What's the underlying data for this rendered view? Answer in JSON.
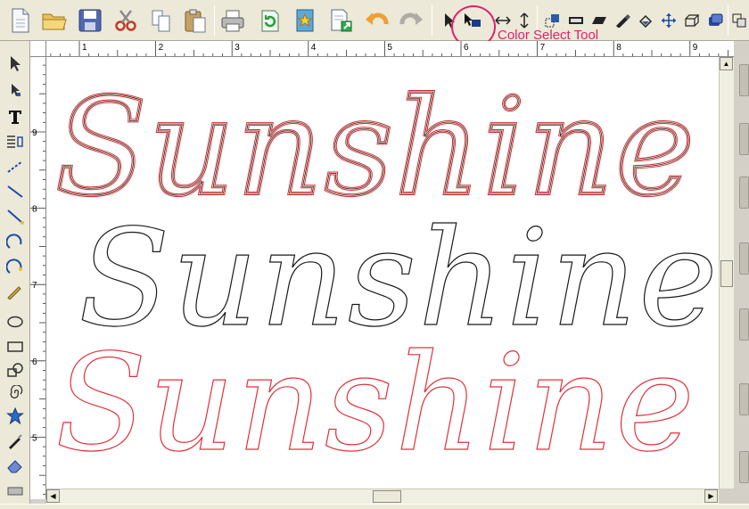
{
  "callout": {
    "label": "Color Select Tool"
  },
  "ruler": {
    "h_labels": [
      "1",
      "2",
      "3",
      "4",
      "5",
      "6",
      "7",
      "8",
      "9"
    ],
    "v_labels": [
      "9",
      "8",
      "7",
      "6",
      "5"
    ]
  },
  "canvas": {
    "words": [
      {
        "text": "Sunshine",
        "style": "outline-red-double",
        "stroke": "#d42a2a"
      },
      {
        "text": "Sunshine",
        "style": "outline-black",
        "stroke": "#1a1a1a"
      },
      {
        "text": "Sunshine",
        "style": "outline-red",
        "stroke": "#e0303a"
      }
    ]
  },
  "toolbar": {
    "icons": [
      "new-document",
      "open-folder",
      "save",
      "cut",
      "copy",
      "paste",
      "print",
      "refresh",
      "import",
      "export",
      "undo",
      "redo",
      "select-arrow",
      "color-select",
      "flip-horizontal",
      "flip-vertical",
      "group",
      "rectangle-fill",
      "slant",
      "paint",
      "fill-shape",
      "move",
      "box-3d",
      "extrude",
      "layers"
    ]
  },
  "colors": {
    "accent": "#e0206e",
    "red": "#d42a2a",
    "black": "#1a1a1a"
  }
}
